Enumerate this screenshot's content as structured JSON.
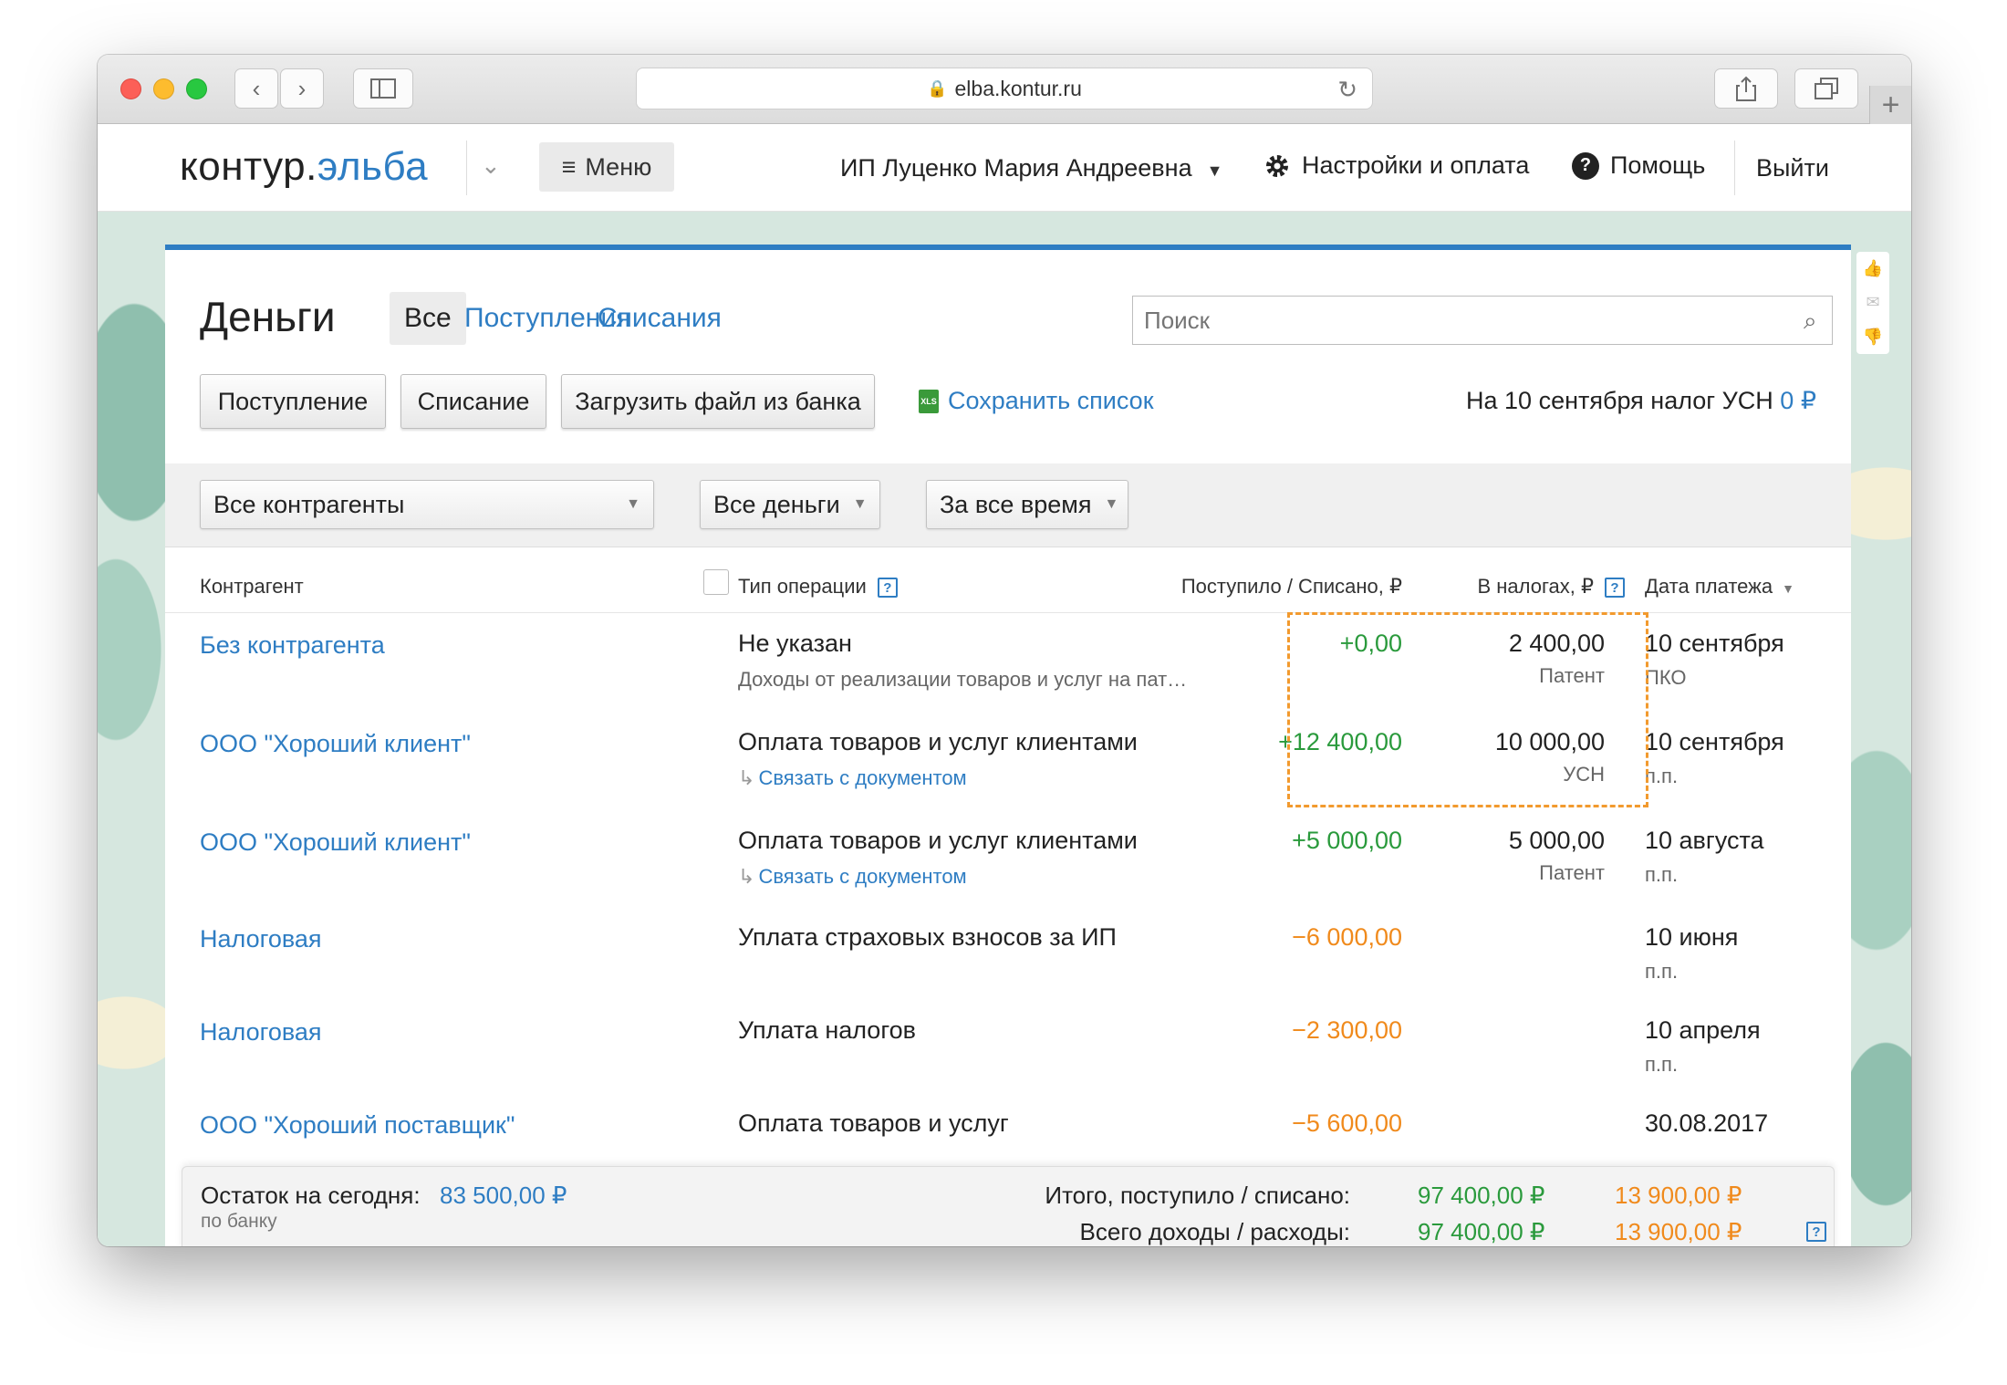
{
  "browser": {
    "url": "elba.kontur.ru",
    "lock_icon": "lock-icon",
    "tab_plus": "+"
  },
  "header": {
    "logo_part1": "контур.",
    "logo_part2": "эльба",
    "menu_label": "Меню",
    "user_name": "ИП Луценко Мария Андреевна",
    "settings_label": "Настройки и оплата",
    "help_label": "Помощь",
    "exit_label": "Выйти"
  },
  "page": {
    "title": "Деньги",
    "tabs": [
      {
        "label": "Все",
        "active": true
      },
      {
        "label": "Поступления",
        "active": false
      },
      {
        "label": "Списания",
        "active": false
      }
    ],
    "search_placeholder": "Поиск"
  },
  "toolbar": {
    "income_button": "Поступление",
    "expense_button": "Списание",
    "upload_button": "Загрузить файл из банка",
    "save_list_label": "Сохранить список",
    "xls_badge": "XLS",
    "tax_note_prefix": "На 10 сентября налог УСН",
    "tax_note_value": "0 ₽"
  },
  "filters": {
    "counterparty": "Все контрагенты",
    "money": "Все деньги",
    "period": "За все время"
  },
  "table": {
    "columns": {
      "counterparty": "Контрагент",
      "operation_type": "Тип операции",
      "amount": "Поступило / Списано, ₽",
      "taxes": "В налогах, ₽",
      "date": "Дата платежа"
    },
    "rows": [
      {
        "counterparty": "Без контрагента",
        "type": "Не указан",
        "sub": "Доходы от реализации товаров и услуг на пат…",
        "link": "",
        "amount": "+0,00",
        "sign": "pos",
        "tax": "2 400,00",
        "tax_sub": "Патент",
        "date": "10 сентября",
        "date_sub": "ПКО"
      },
      {
        "counterparty": "ООО \"Хороший клиент\"",
        "type": "Оплата товаров и услуг клиентами",
        "sub": "",
        "link": "Связать с документом",
        "amount": "+12 400,00",
        "sign": "pos",
        "tax": "10 000,00",
        "tax_sub": "УСН",
        "date": "10 сентября",
        "date_sub": "п.п."
      },
      {
        "counterparty": "ООО \"Хороший клиент\"",
        "type": "Оплата товаров и услуг клиентами",
        "sub": "",
        "link": "Связать с документом",
        "amount": "+5 000,00",
        "sign": "pos",
        "tax": "5 000,00",
        "tax_sub": "Патент",
        "date": "10 августа",
        "date_sub": "п.п."
      },
      {
        "counterparty": "Налоговая",
        "type": "Уплата страховых взносов за ИП",
        "sub": "",
        "link": "",
        "amount": "−6 000,00",
        "sign": "neg",
        "tax": "",
        "tax_sub": "",
        "date": "10 июня",
        "date_sub": "п.п."
      },
      {
        "counterparty": "Налоговая",
        "type": "Уплата налогов",
        "sub": "",
        "link": "",
        "amount": "−2 300,00",
        "sign": "neg",
        "tax": "",
        "tax_sub": "",
        "date": "10 апреля",
        "date_sub": "п.п."
      },
      {
        "counterparty": "ООО \"Хороший поставщик\"",
        "type": "Оплата товаров и услуг",
        "sub": "",
        "link": "",
        "amount": "−5 600,00",
        "sign": "neg",
        "tax": "",
        "tax_sub": "",
        "date": "30.08.2017",
        "date_sub": ""
      }
    ]
  },
  "footer": {
    "balance_label": "Остаток на сегодня:",
    "balance_value": "83 500,00 ₽",
    "balance_source": "по банку",
    "totals_label": "Итого, поступило / списано:",
    "totals_in": "97 400,00 ₽",
    "totals_out": "13 900,00 ₽",
    "all_label": "Всего доходы / расходы:",
    "all_in": "97 400,00 ₽",
    "all_out": "13 900,00 ₽"
  },
  "colors": {
    "accent": "#2e7dc3",
    "positive": "#2a9a3c",
    "negative": "#f08a1c",
    "highlight": "#f29a2e"
  }
}
